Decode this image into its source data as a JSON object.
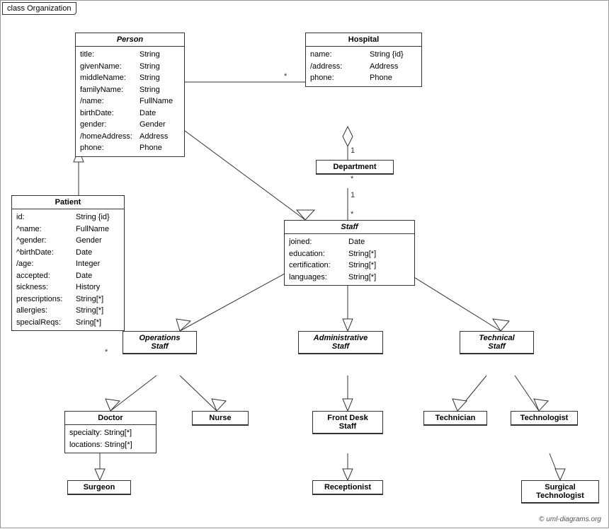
{
  "diagram": {
    "title": "class Organization",
    "copyright": "© uml-diagrams.org",
    "classes": {
      "person": {
        "name": "Person",
        "italic": true,
        "attrs": [
          {
            "name": "title:",
            "type": "String"
          },
          {
            "name": "givenName:",
            "type": "String"
          },
          {
            "name": "middleName:",
            "type": "String"
          },
          {
            "name": "familyName:",
            "type": "String"
          },
          {
            "name": "/name:",
            "type": "FullName"
          },
          {
            "name": "birthDate:",
            "type": "Date"
          },
          {
            "name": "gender:",
            "type": "Gender"
          },
          {
            "name": "/homeAddress:",
            "type": "Address"
          },
          {
            "name": "phone:",
            "type": "Phone"
          }
        ]
      },
      "hospital": {
        "name": "Hospital",
        "attrs": [
          {
            "name": "name:",
            "type": "String {id}"
          },
          {
            "name": "/address:",
            "type": "Address"
          },
          {
            "name": "phone:",
            "type": "Phone"
          }
        ]
      },
      "department": {
        "name": "Department",
        "attrs": []
      },
      "staff": {
        "name": "Staff",
        "italic": true,
        "attrs": [
          {
            "name": "joined:",
            "type": "Date"
          },
          {
            "name": "education:",
            "type": "String[*]"
          },
          {
            "name": "certification:",
            "type": "String[*]"
          },
          {
            "name": "languages:",
            "type": "String[*]"
          }
        ]
      },
      "patient": {
        "name": "Patient",
        "attrs": [
          {
            "name": "id:",
            "type": "String {id}"
          },
          {
            "name": "^name:",
            "type": "FullName"
          },
          {
            "name": "^gender:",
            "type": "Gender"
          },
          {
            "name": "^birthDate:",
            "type": "Date"
          },
          {
            "name": "/age:",
            "type": "Integer"
          },
          {
            "name": "accepted:",
            "type": "Date"
          },
          {
            "name": "sickness:",
            "type": "History"
          },
          {
            "name": "prescriptions:",
            "type": "String[*]"
          },
          {
            "name": "allergies:",
            "type": "String[*]"
          },
          {
            "name": "specialReqs:",
            "type": "Sring[*]"
          }
        ]
      },
      "operations_staff": {
        "name": "Operations Staff",
        "italic": true,
        "attrs": []
      },
      "administrative_staff": {
        "name": "Administrative Staff",
        "italic": true,
        "attrs": []
      },
      "technical_staff": {
        "name": "Technical Staff",
        "italic": true,
        "attrs": []
      },
      "doctor": {
        "name": "Doctor",
        "attrs": [
          {
            "name": "specialty:",
            "type": "String[*]"
          },
          {
            "name": "locations:",
            "type": "String[*]"
          }
        ]
      },
      "nurse": {
        "name": "Nurse",
        "attrs": []
      },
      "front_desk_staff": {
        "name": "Front Desk Staff",
        "attrs": []
      },
      "technician": {
        "name": "Technician",
        "attrs": []
      },
      "technologist": {
        "name": "Technologist",
        "attrs": []
      },
      "surgeon": {
        "name": "Surgeon",
        "attrs": []
      },
      "receptionist": {
        "name": "Receptionist",
        "attrs": []
      },
      "surgical_technologist": {
        "name": "Surgical Technologist",
        "attrs": []
      }
    }
  }
}
